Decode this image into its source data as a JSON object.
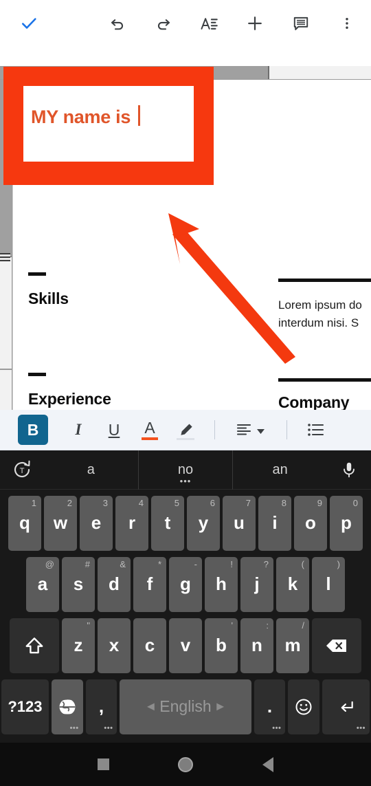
{
  "app_bar": {
    "done_icon": "check-icon",
    "actions": [
      {
        "name": "undo-button",
        "icon": "undo-icon"
      },
      {
        "name": "redo-button",
        "icon": "redo-icon"
      },
      {
        "name": "format-button",
        "icon": "text-format-icon"
      },
      {
        "name": "insert-button",
        "icon": "plus-icon"
      },
      {
        "name": "comment-button",
        "icon": "comment-icon"
      },
      {
        "name": "overflow-button",
        "icon": "more-vert-icon"
      }
    ]
  },
  "annotation": {
    "box_color": "#f6380f",
    "arrow_color": "#f4390f",
    "typed_text": "MY name is ",
    "typed_text_color": "#e0552a"
  },
  "document": {
    "left_column": {
      "skills_heading": "Skills",
      "experience_heading": "Experience"
    },
    "right_column": {
      "paragraph_line1": "Lorem ipsum do",
      "paragraph_line2": "interdum nisi. S",
      "company_heading": "Company Na"
    }
  },
  "format_toolbar": {
    "bold_label": "B",
    "bold_active": true,
    "italic_label": "I",
    "underline_label": "U",
    "text_color_label": "A",
    "text_color_swatch": "#f4511e",
    "highlight_icon": "highlighter-icon",
    "align_icon": "align-left-icon",
    "align_dropdown_icon": "caret-down-icon",
    "list_icon": "bulleted-list-icon"
  },
  "keyboard": {
    "suggestion_bar": {
      "left_icon": "rotate-translate-icon",
      "mic_icon": "microphone-icon",
      "suggestions": [
        {
          "text": "a",
          "active": false
        },
        {
          "text": "no",
          "active": true
        },
        {
          "text": "an",
          "active": false
        }
      ],
      "active_dots": "•••"
    },
    "row1": [
      {
        "key": "q",
        "hint": "1"
      },
      {
        "key": "w",
        "hint": "2"
      },
      {
        "key": "e",
        "hint": "3"
      },
      {
        "key": "r",
        "hint": "4"
      },
      {
        "key": "t",
        "hint": "5"
      },
      {
        "key": "y",
        "hint": "6"
      },
      {
        "key": "u",
        "hint": "7"
      },
      {
        "key": "i",
        "hint": "8"
      },
      {
        "key": "o",
        "hint": "9"
      },
      {
        "key": "p",
        "hint": "0"
      }
    ],
    "row2": [
      {
        "key": "a",
        "hint": "@"
      },
      {
        "key": "s",
        "hint": "#"
      },
      {
        "key": "d",
        "hint": "&"
      },
      {
        "key": "f",
        "hint": "*"
      },
      {
        "key": "g",
        "hint": "-"
      },
      {
        "key": "h",
        "hint": "!"
      },
      {
        "key": "j",
        "hint": "?"
      },
      {
        "key": "k",
        "hint": "("
      },
      {
        "key": "l",
        "hint": ")"
      }
    ],
    "row3": {
      "shift_icon": "shift-arrow-icon",
      "keys": [
        {
          "key": "z",
          "hint": "\""
        },
        {
          "key": "x",
          "hint": ""
        },
        {
          "key": "c",
          "hint": ""
        },
        {
          "key": "v",
          "hint": ""
        },
        {
          "key": "b",
          "hint": "'"
        },
        {
          "key": "n",
          "hint": ":"
        },
        {
          "key": "m",
          "hint": "/"
        }
      ],
      "backspace_icon": "backspace-icon"
    },
    "row4": {
      "symbols_label": "?123",
      "globe_icon": "globe-language-icon",
      "comma_label": ",",
      "space_label": "English",
      "space_left_arrow": "◄",
      "space_right_arrow": "►",
      "period_label": ".",
      "emoji_icon": "emoji-smiley-icon",
      "enter_icon": "enter-return-icon",
      "dots": "•••"
    }
  },
  "nav_bar": {
    "recents_icon": "recents-square-icon",
    "home_icon": "home-circle-icon",
    "back_icon": "back-triangle-icon"
  }
}
